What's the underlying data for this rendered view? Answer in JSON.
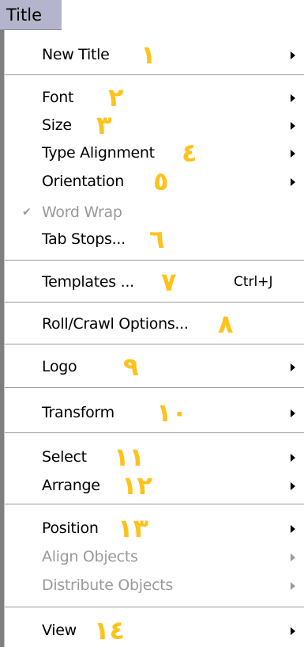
{
  "menubar": {
    "title": "Title"
  },
  "items": [
    {
      "label": "New Title",
      "number": "١",
      "submenu": true
    },
    {
      "label": "Font",
      "number": "٢",
      "submenu": true
    },
    {
      "label": "Size",
      "number": "٣",
      "submenu": true
    },
    {
      "label": "Type Alignment",
      "number": "٤",
      "submenu": true
    },
    {
      "label": "Orientation",
      "number": "٥",
      "submenu": true
    },
    {
      "label": "Word Wrap",
      "checked": true,
      "disabled": true
    },
    {
      "label": "Tab Stops...",
      "number": "٦"
    },
    {
      "label": "Templates ...",
      "number": "٧",
      "shortcut": "Ctrl+J"
    },
    {
      "label": "Roll/Crawl Options...",
      "number": "٨"
    },
    {
      "label": "Logo",
      "number": "٩",
      "submenu": true
    },
    {
      "label": "Transform",
      "number": "١٠",
      "submenu": true
    },
    {
      "label": "Select",
      "number": "١١",
      "submenu": true
    },
    {
      "label": "Arrange",
      "number": "١٢",
      "submenu": true
    },
    {
      "label": "Position",
      "number": "١٣",
      "submenu": true
    },
    {
      "label": "Align Objects",
      "disabled": true,
      "submenu": true
    },
    {
      "label": "Distribute Objects",
      "disabled": true,
      "submenu": true
    },
    {
      "label": "View",
      "number": "١٤",
      "submenu": true
    }
  ],
  "accent_color": "#ffc21a"
}
